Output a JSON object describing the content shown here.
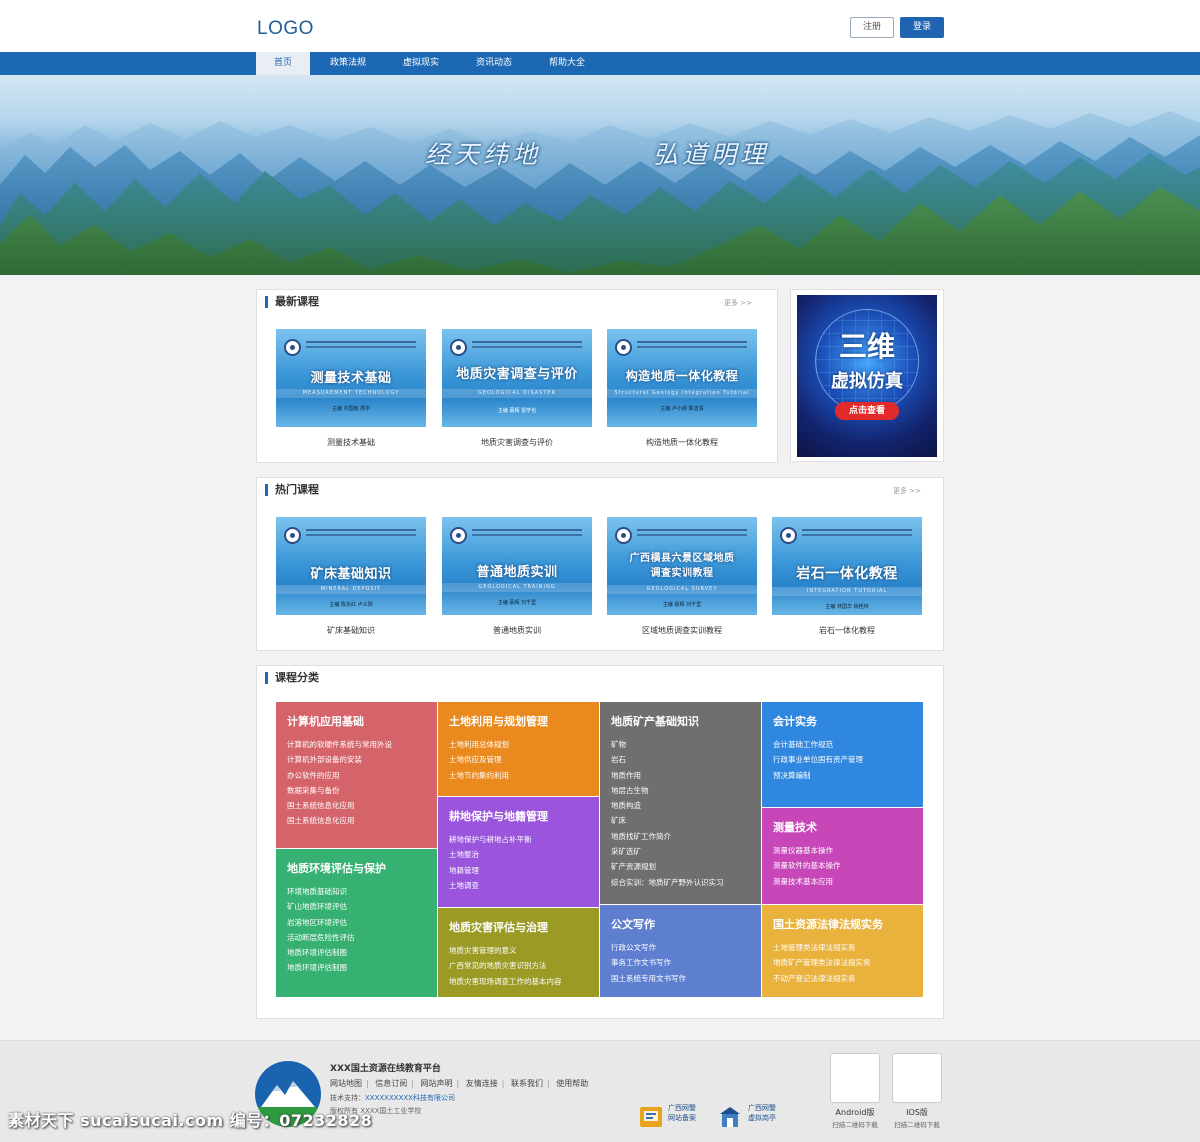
{
  "header": {
    "logo": "LOGO",
    "register_label": "注册",
    "login_label": "登录"
  },
  "nav": {
    "items": [
      "首页",
      "政策法规",
      "虚拟现实",
      "资讯动态",
      "帮助大全"
    ],
    "active_index": 0
  },
  "banner": {
    "slogan_left": "经天纬地",
    "slogan_right": "弘道明理"
  },
  "latest": {
    "title": "最新课程",
    "more": "更多 >>",
    "courses": [
      {
        "cover_title": "测量技术基础",
        "cover_sub": "MEASUREMENT TECHNOLOGY",
        "author": "主编 刘国敏 周宇",
        "name": "测量技术基础"
      },
      {
        "cover_title": "地质灾害调查与评价",
        "cover_sub": "GEOLOGICAL DISASTER",
        "author": "主编 蔡辉 雷学也",
        "name": "地质灾害调查与评价"
      },
      {
        "cover_title": "构造地质一体化教程",
        "cover_sub": "Structural Geology Integration Tutorial",
        "author": "主编 卢小妮 陈洁清",
        "name": "构造地质一体化教程"
      }
    ]
  },
  "ad": {
    "line1": "三维",
    "line2": "虚拟仿真",
    "button": "点击查看"
  },
  "hot": {
    "title": "热门课程",
    "more": "更多 >>",
    "courses": [
      {
        "cover_title": "矿床基础知识",
        "cover_sub": "MINERAL DEPOSIT",
        "author": "主编 陈永红 卢义则",
        "name": "矿床基础知识"
      },
      {
        "cover_title": "普通地质实训",
        "cover_sub": "GEOLOGICAL TRAINING",
        "author": "主编 蔡辉 刘千里",
        "name": "普通地质实训"
      },
      {
        "cover_title": "广西横县六景区域地质调查实训教程",
        "cover_sub": "GEOLOGICAL SURVEY",
        "author": "主编 蔡辉 刘千里",
        "name": "区域地质调查实训教程"
      },
      {
        "cover_title": "岩石一体化教程",
        "cover_sub": "INTEGRATION TUTORIAL",
        "author": "主编 林国华 姚桂林",
        "name": "岩石一体化教程"
      }
    ]
  },
  "categories": {
    "title": "课程分类",
    "blocks": [
      {
        "title": "计算机应用基础",
        "color": "#d5646a",
        "items": [
          "计算机的软硬件系统与常用外设",
          "计算机外部设备的安装",
          "办公软件的应用",
          "数据采集与备份",
          "国土系统信息化应用",
          "国土系统信息化应用"
        ]
      },
      {
        "title": "地质环境评估与保护",
        "color": "#36b172",
        "items": [
          "环境地质基础知识",
          "矿山地质环境评估",
          "岩溶地区环境评估",
          "活动断层危险性评估",
          "地质环境评估制图",
          "地质环境评估制图"
        ]
      },
      {
        "title": "土地利用与规划管理",
        "color": "#ea8a1e",
        "items": [
          "土地利用总体规划",
          "土地供应及管理",
          "土地节约集约利用"
        ]
      },
      {
        "title": "耕地保护与地籍管理",
        "color": "#9a55dc",
        "items": [
          "耕地保护与耕地占补平衡",
          "土地整治",
          "地籍管理",
          "土地调查"
        ]
      },
      {
        "title": "地质灾害评估与治理",
        "color": "#9a9a24",
        "items": [
          "地质灾害管理的意义",
          "广西常见的地质灾害识别方法",
          "地质灾害现场调查工作的基本内容"
        ]
      },
      {
        "title": "地质矿产基础知识",
        "color": "#6f6f6f",
        "items": [
          "矿物",
          "岩石",
          "地质作用",
          "地层古生物",
          "地质构造",
          "矿床",
          "地质找矿工作简介",
          "采矿选矿",
          "矿产资源规划",
          "综合实训：地质矿产野外认识实习"
        ]
      },
      {
        "title": "公文写作",
        "color": "#5e7fd0",
        "items": [
          "行政公文写作",
          "事务工作文书写作",
          "国土系统专用文书写作"
        ]
      },
      {
        "title": "会计实务",
        "color": "#2f87df",
        "items": [
          "会计基础工作规范",
          "行政事业单位国有资产管理",
          "预决算编制"
        ]
      },
      {
        "title": "测量技术",
        "color": "#c746b8",
        "items": [
          "测量仪器基本操作",
          "测量软件的基本操作",
          "测量技术基本应用"
        ]
      },
      {
        "title": "国土资源法律法规实务",
        "color": "#e9b23d",
        "items": [
          "土地管理类法律法规实务",
          "地质矿产管理类法律法规实务",
          "不动产登记法律法规实务"
        ]
      }
    ]
  },
  "footer": {
    "org": "XXX国土资源在线教育平台",
    "links": [
      "网站地图",
      "信息订阅",
      "网站声明",
      "友情连接",
      "联系我们",
      "使用帮助"
    ],
    "tech_label": "技术支持：",
    "tech_value": "XXXXXXXXXX科技有限公司",
    "address": "版权所有 XXXX国土工业学校",
    "badges": [
      {
        "line1": "广西网警",
        "line2": "网站备案"
      },
      {
        "line1": "广西网警",
        "line2": "虚拟岗亭"
      }
    ],
    "apps": [
      {
        "label": "Android版",
        "sub": "扫描二维码下载"
      },
      {
        "label": "IOS版",
        "sub": "扫描二维码下载"
      }
    ]
  },
  "watermark": "素材天下 sucaisucai.com  编号：07232828"
}
